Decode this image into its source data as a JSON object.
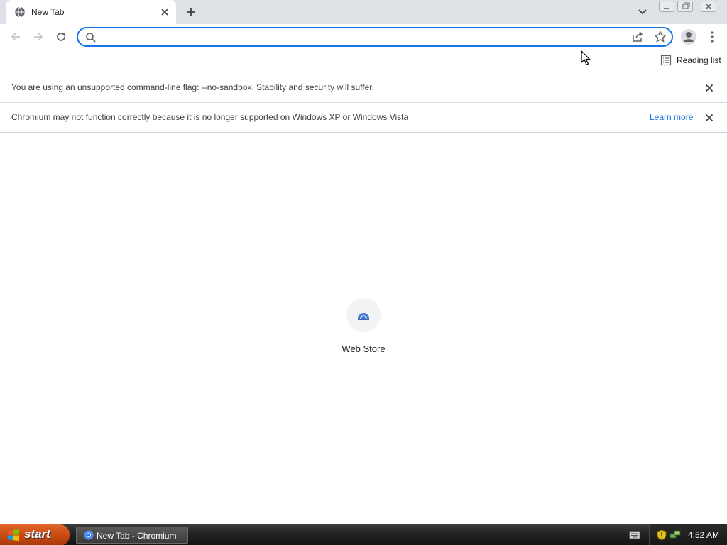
{
  "browser": {
    "tab": {
      "title": "New Tab"
    },
    "omnibox": {
      "value": "",
      "placeholder": ""
    },
    "bookmark_bar": {
      "reading_list_label": "Reading list"
    }
  },
  "infobars": [
    {
      "message": "You are using an unsupported command-line flag: --no-sandbox. Stability and security will suffer."
    },
    {
      "message": "Chromium may not function correctly because it is no longer supported on Windows XP or Windows Vista",
      "link": "Learn more"
    }
  ],
  "new_tab_page": {
    "shortcuts": [
      {
        "label": "Web Store",
        "icon": "webstore-icon"
      }
    ]
  },
  "taskbar": {
    "start_label": "start",
    "window_button_label": "New Tab - Chromium",
    "clock": "4:52 AM"
  },
  "colors": {
    "accent": "#1a73e8",
    "tabstrip": "#dee1e6",
    "start_button": "#c94b13",
    "taskbar": "#222222"
  }
}
